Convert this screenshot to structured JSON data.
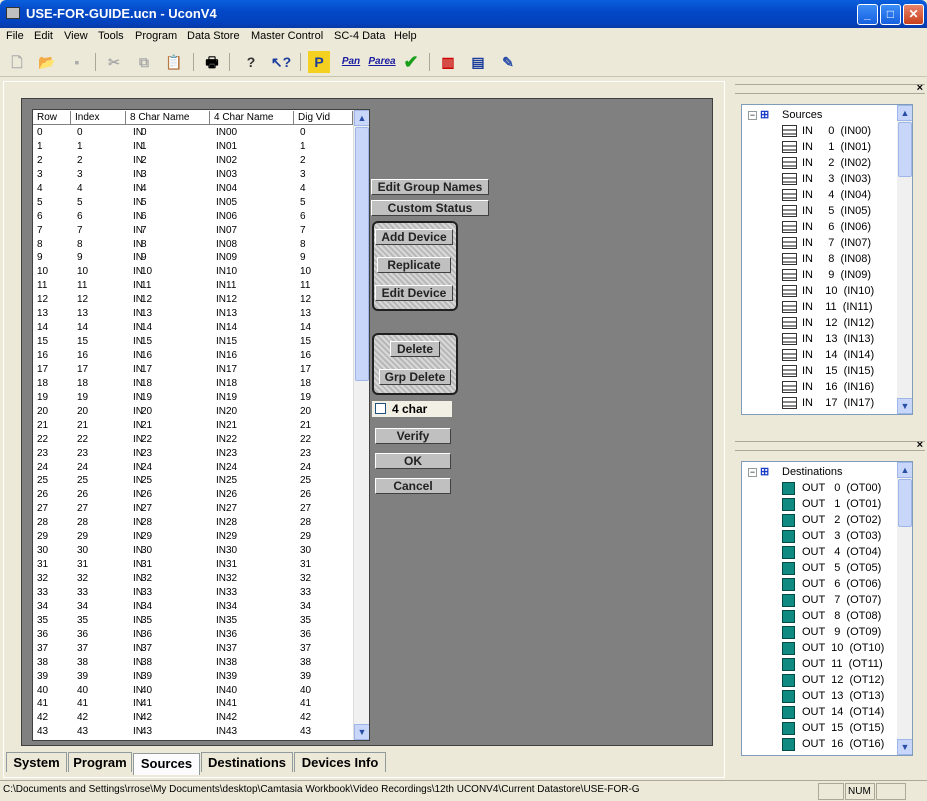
{
  "window": {
    "title": "USE-FOR-GUIDE.ucn - UconV4"
  },
  "menu": [
    "File",
    "Edit",
    "View",
    "Tools",
    "Program",
    "Data Store",
    "Master Control",
    "SC-4 Data",
    "Help"
  ],
  "toolbar": {
    "pan_label": "Pan",
    "parea_label": "Parea"
  },
  "grid": {
    "headers": [
      "Row",
      "Index",
      "8 Char Name",
      "4 Char Name",
      "Dig Vid"
    ],
    "rows": [
      [
        "0",
        "0",
        "IN",
        "0",
        "IN00",
        "0"
      ],
      [
        "1",
        "1",
        "IN",
        "1",
        "IN01",
        "1"
      ],
      [
        "2",
        "2",
        "IN",
        "2",
        "IN02",
        "2"
      ],
      [
        "3",
        "3",
        "IN",
        "3",
        "IN03",
        "3"
      ],
      [
        "4",
        "4",
        "IN",
        "4",
        "IN04",
        "4"
      ],
      [
        "5",
        "5",
        "IN",
        "5",
        "IN05",
        "5"
      ],
      [
        "6",
        "6",
        "IN",
        "6",
        "IN06",
        "6"
      ],
      [
        "7",
        "7",
        "IN",
        "7",
        "IN07",
        "7"
      ],
      [
        "8",
        "8",
        "IN",
        "8",
        "IN08",
        "8"
      ],
      [
        "9",
        "9",
        "IN",
        "9",
        "IN09",
        "9"
      ],
      [
        "10",
        "10",
        "IN",
        "10",
        "IN10",
        "10"
      ],
      [
        "11",
        "11",
        "IN",
        "11",
        "IN11",
        "11"
      ],
      [
        "12",
        "12",
        "IN",
        "12",
        "IN12",
        "12"
      ],
      [
        "13",
        "13",
        "IN",
        "13",
        "IN13",
        "13"
      ],
      [
        "14",
        "14",
        "IN",
        "14",
        "IN14",
        "14"
      ],
      [
        "15",
        "15",
        "IN",
        "15",
        "IN15",
        "15"
      ],
      [
        "16",
        "16",
        "IN",
        "16",
        "IN16",
        "16"
      ],
      [
        "17",
        "17",
        "IN",
        "17",
        "IN17",
        "17"
      ],
      [
        "18",
        "18",
        "IN",
        "18",
        "IN18",
        "18"
      ],
      [
        "19",
        "19",
        "IN",
        "19",
        "IN19",
        "19"
      ],
      [
        "20",
        "20",
        "IN",
        "20",
        "IN20",
        "20"
      ],
      [
        "21",
        "21",
        "IN",
        "21",
        "IN21",
        "21"
      ],
      [
        "22",
        "22",
        "IN",
        "22",
        "IN22",
        "22"
      ],
      [
        "23",
        "23",
        "IN",
        "23",
        "IN23",
        "23"
      ],
      [
        "24",
        "24",
        "IN",
        "24",
        "IN24",
        "24"
      ],
      [
        "25",
        "25",
        "IN",
        "25",
        "IN25",
        "25"
      ],
      [
        "26",
        "26",
        "IN",
        "26",
        "IN26",
        "26"
      ],
      [
        "27",
        "27",
        "IN",
        "27",
        "IN27",
        "27"
      ],
      [
        "28",
        "28",
        "IN",
        "28",
        "IN28",
        "28"
      ],
      [
        "29",
        "29",
        "IN",
        "29",
        "IN29",
        "29"
      ],
      [
        "30",
        "30",
        "IN",
        "30",
        "IN30",
        "30"
      ],
      [
        "31",
        "31",
        "IN",
        "31",
        "IN31",
        "31"
      ],
      [
        "32",
        "32",
        "IN",
        "32",
        "IN32",
        "32"
      ],
      [
        "33",
        "33",
        "IN",
        "33",
        "IN33",
        "33"
      ],
      [
        "34",
        "34",
        "IN",
        "34",
        "IN34",
        "34"
      ],
      [
        "35",
        "35",
        "IN",
        "35",
        "IN35",
        "35"
      ],
      [
        "36",
        "36",
        "IN",
        "36",
        "IN36",
        "36"
      ],
      [
        "37",
        "37",
        "IN",
        "37",
        "IN37",
        "37"
      ],
      [
        "38",
        "38",
        "IN",
        "38",
        "IN38",
        "38"
      ],
      [
        "39",
        "39",
        "IN",
        "39",
        "IN39",
        "39"
      ],
      [
        "40",
        "40",
        "IN",
        "40",
        "IN40",
        "40"
      ],
      [
        "41",
        "41",
        "IN",
        "41",
        "IN41",
        "41"
      ],
      [
        "42",
        "42",
        "IN",
        "42",
        "IN42",
        "42"
      ],
      [
        "43",
        "43",
        "IN",
        "43",
        "IN43",
        "43"
      ]
    ]
  },
  "buttons": {
    "edit_group_names": "Edit Group Names",
    "custom_status": "Custom Status",
    "add_device": "Add Device",
    "replicate": "Replicate",
    "edit_device": "Edit Device",
    "delete": "Delete",
    "grp_delete": "Grp Delete",
    "four_char": "4 char",
    "verify": "Verify",
    "ok": "OK",
    "cancel": "Cancel"
  },
  "tabs": [
    "System",
    "Program",
    "Sources",
    "Destinations",
    "Devices Info"
  ],
  "active_tab": "Sources",
  "sources": {
    "root": "Sources",
    "items": [
      "IN     0  (IN00)",
      "IN     1  (IN01)",
      "IN     2  (IN02)",
      "IN     3  (IN03)",
      "IN     4  (IN04)",
      "IN     5  (IN05)",
      "IN     6  (IN06)",
      "IN     7  (IN07)",
      "IN     8  (IN08)",
      "IN     9  (IN09)",
      "IN    10  (IN10)",
      "IN    11  (IN11)",
      "IN    12  (IN12)",
      "IN    13  (IN13)",
      "IN    14  (IN14)",
      "IN    15  (IN15)",
      "IN    16  (IN16)",
      "IN    17  (IN17)"
    ]
  },
  "destinations": {
    "root": "Destinations",
    "items": [
      "OUT   0  (OT00)",
      "OUT   1  (OT01)",
      "OUT   2  (OT02)",
      "OUT   3  (OT03)",
      "OUT   4  (OT04)",
      "OUT   5  (OT05)",
      "OUT   6  (OT06)",
      "OUT   7  (OT07)",
      "OUT   8  (OT08)",
      "OUT   9  (OT09)",
      "OUT  10  (OT10)",
      "OUT  11  (OT11)",
      "OUT  12  (OT12)",
      "OUT  13  (OT13)",
      "OUT  14  (OT14)",
      "OUT  15  (OT15)",
      "OUT  16  (OT16)"
    ]
  },
  "status": {
    "path": "C:\\Documents and Settings\\rrose\\My Documents\\desktop\\Camtasia Workbook\\Video Recordings\\12th UCONV4\\Current Datastore\\USE-FOR-G",
    "num": "NUM"
  },
  "colors": {
    "titlebar": "#0348c7",
    "content_bg": "#808080",
    "panel_bg": "#ece9d8"
  }
}
